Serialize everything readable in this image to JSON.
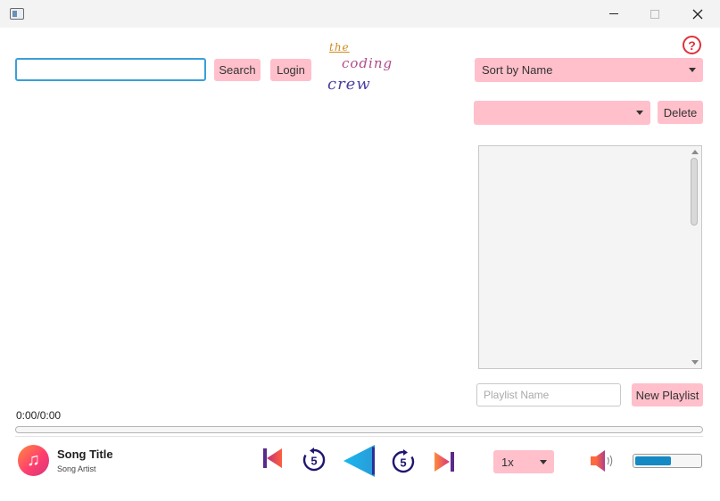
{
  "window": {
    "title": ""
  },
  "search": {
    "value": "",
    "placeholder": "",
    "button_label": "Search"
  },
  "login": {
    "label": "Login"
  },
  "logo": {
    "line1": "the",
    "line2": "coding",
    "line3": "crew"
  },
  "sort": {
    "selected": "Sort by Name"
  },
  "playlist": {
    "selected": "",
    "delete_label": "Delete",
    "items": [],
    "name_placeholder": "Playlist Name",
    "new_label": "New Playlist"
  },
  "player": {
    "time": "0:00/0:00",
    "progress": 0,
    "song_title": "Song Title",
    "song_artist": "Song Artist",
    "rewind_seconds": "5",
    "forward_seconds": "5",
    "speed": "1x",
    "volume": 0.55
  },
  "icons": {
    "album_art": "music-note-icon",
    "help": "question-mark-icon",
    "prev": "skip-previous-icon",
    "rewind": "replay-5-icon",
    "play": "play-icon",
    "forward": "forward-5-icon",
    "next": "skip-next-icon",
    "volume": "speaker-icon"
  },
  "colors": {
    "button_pink": "#ffc0cb",
    "focus_blue": "#3a9fd8",
    "volume_blue": "#1489c4",
    "help_red": "#e0303a"
  }
}
